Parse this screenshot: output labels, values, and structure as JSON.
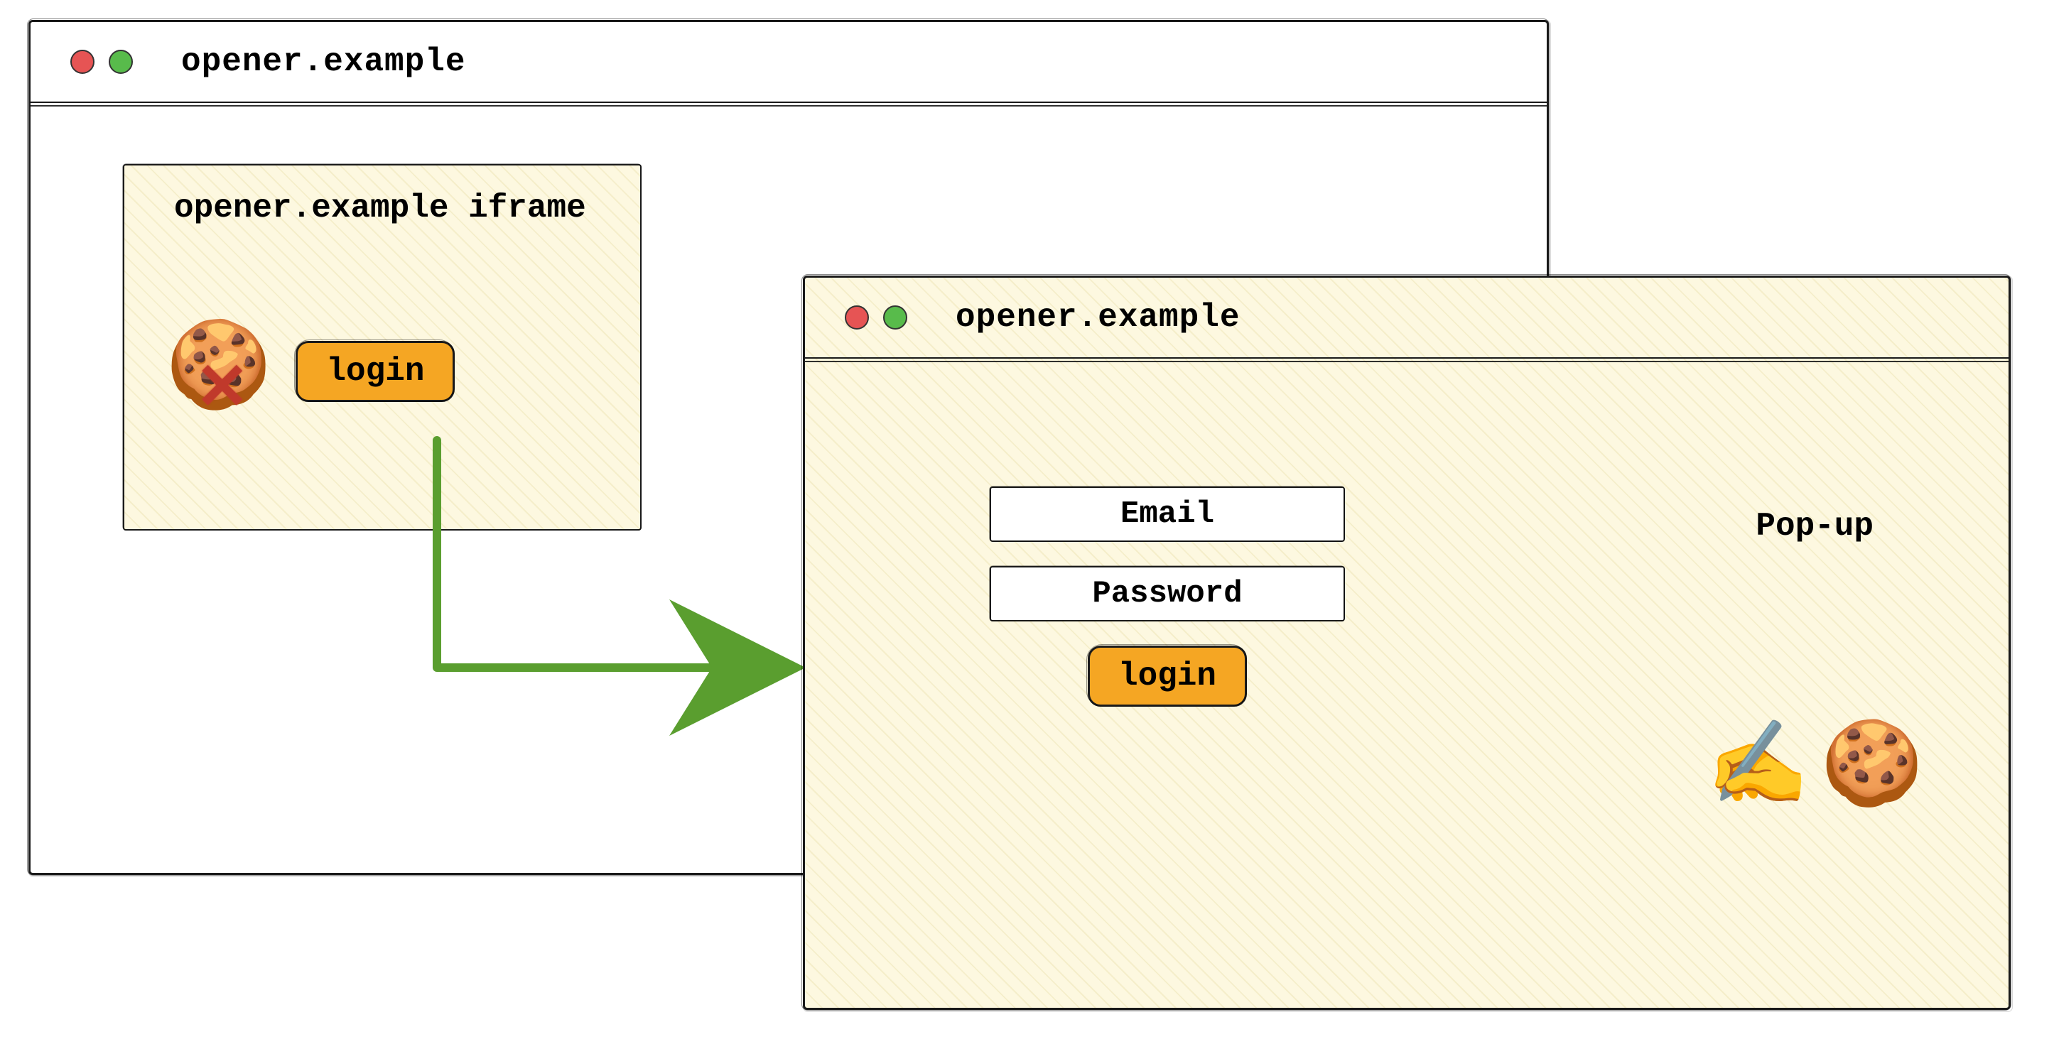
{
  "colors": {
    "accent_button": "#f5a623",
    "arrow": "#5a9e2f",
    "traffic_red": "#e65454",
    "traffic_green": "#58bb4b",
    "cross": "#c0392b",
    "hatch_bg": "#fdf8e0"
  },
  "windowA": {
    "title": "opener.example",
    "iframe": {
      "label": "opener.example iframe",
      "cookie_icon": "cookie",
      "cross_icon": "cross",
      "login_button_label": "login"
    }
  },
  "windowB": {
    "title": "opener.example",
    "popup_label": "Pop-up",
    "form": {
      "email_label": "Email",
      "password_label": "Password",
      "login_button_label": "login"
    },
    "icons": {
      "writing_hand": "writing-hand",
      "cookie": "cookie"
    }
  },
  "arrow": {
    "from": "windowA.iframe.login_button",
    "to": "windowB"
  }
}
